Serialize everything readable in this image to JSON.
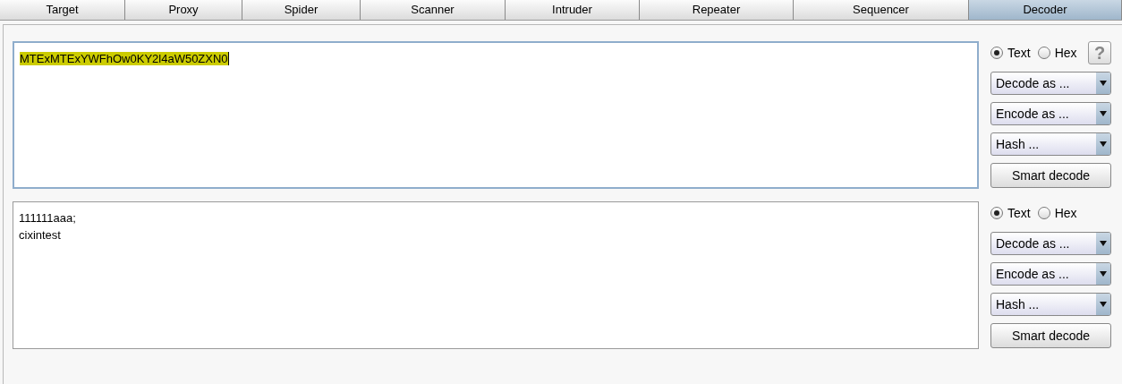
{
  "tabs": [
    {
      "label": "Target",
      "selected": false
    },
    {
      "label": "Proxy",
      "selected": false
    },
    {
      "label": "Spider",
      "selected": false
    },
    {
      "label": "Scanner",
      "selected": false
    },
    {
      "label": "Intruder",
      "selected": false
    },
    {
      "label": "Repeater",
      "selected": false
    },
    {
      "label": "Sequencer",
      "selected": false
    },
    {
      "label": "Decoder",
      "selected": true
    }
  ],
  "panels": [
    {
      "focused": true,
      "highlighted": true,
      "lines": [
        "MTExMTExYWFhOw0KY2l4aW50ZXN0"
      ],
      "formats": [
        {
          "label": "Text",
          "selected": true
        },
        {
          "label": "Hex",
          "selected": false
        }
      ],
      "help_button": "?",
      "dropdowns": [
        "Decode as ...",
        "Encode as ...",
        "Hash ..."
      ],
      "smart_decode": "Smart decode"
    },
    {
      "focused": false,
      "highlighted": false,
      "lines": [
        "111111aaa;",
        "cixintest"
      ],
      "formats": [
        {
          "label": "Text",
          "selected": true
        },
        {
          "label": "Hex",
          "selected": false
        }
      ],
      "dropdowns": [
        "Decode as ...",
        "Encode as ...",
        "Hash ..."
      ],
      "smart_decode": "Smart decode"
    }
  ]
}
